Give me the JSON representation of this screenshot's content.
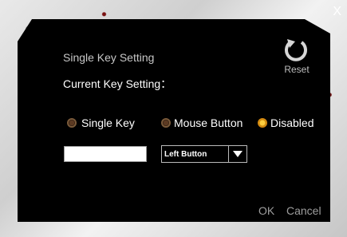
{
  "dialog": {
    "close_label": "X",
    "title": "Single Key Setting",
    "current_label": "Current Key Setting：",
    "reset_label": "Reset",
    "options": [
      {
        "label": "Single Key",
        "selected": false
      },
      {
        "label": "Mouse Button",
        "selected": false
      },
      {
        "label": "Disabled",
        "selected": true
      }
    ],
    "key_input_value": "",
    "mouse_select_value": "Left Button",
    "ok_label": "OK",
    "cancel_label": "Cancel"
  },
  "icons": {
    "reset": "reset-icon",
    "dropdown": "chevron-down-icon",
    "close": "close-icon"
  },
  "colors": {
    "accent_radio": "#d58a10",
    "panel": "#000000"
  }
}
